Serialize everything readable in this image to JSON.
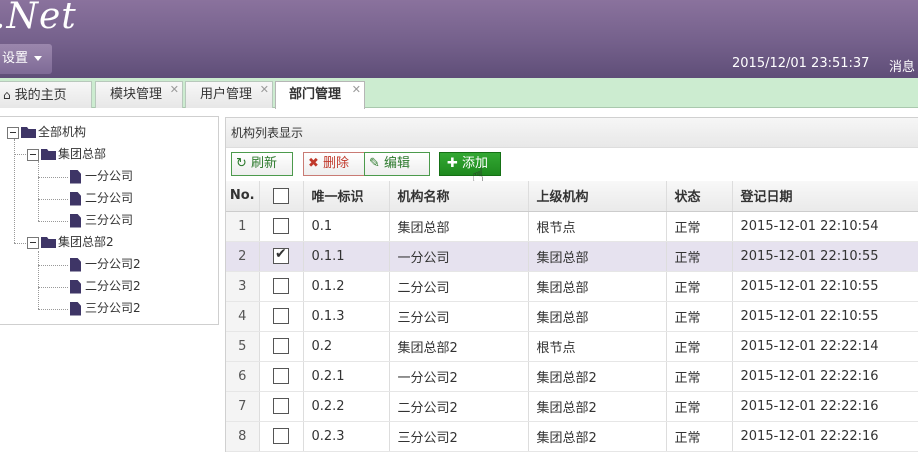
{
  "header": {
    "logo_text": ".Net",
    "settings_label": "设置",
    "datetime": "2015/12/01 23:51:37",
    "message_label": "消息 ("
  },
  "tabs": [
    {
      "label": "我的主页",
      "icon": "home-icon"
    },
    {
      "label": "模块管理"
    },
    {
      "label": "用户管理"
    },
    {
      "label": "部门管理",
      "active": true
    }
  ],
  "tree": {
    "root": "全部机构",
    "groups": [
      {
        "label": "集团总部",
        "children": [
          "一分公司",
          "二分公司",
          "三分公司"
        ]
      },
      {
        "label": "集团总部2",
        "children": [
          "一分公司2",
          "二分公司2",
          "三分公司2"
        ]
      }
    ]
  },
  "panel": {
    "title": "机构列表显示",
    "buttons": {
      "refresh": "刷新",
      "delete": "删除",
      "edit": "编辑",
      "add": "添加"
    }
  },
  "table": {
    "headers": [
      "No.",
      "",
      "唯一标识",
      "机构名称",
      "上级机构",
      "状态",
      "登记日期"
    ],
    "rows": [
      {
        "no": "1",
        "checked": false,
        "id": "0.1",
        "name": "集团总部",
        "parent": "根节点",
        "status": "正常",
        "date": "2015-12-01 22:10:54"
      },
      {
        "no": "2",
        "checked": true,
        "id": "0.1.1",
        "name": "一分公司",
        "parent": "集团总部",
        "status": "正常",
        "date": "2015-12-01 22:10:55"
      },
      {
        "no": "3",
        "checked": false,
        "id": "0.1.2",
        "name": "二分公司",
        "parent": "集团总部",
        "status": "正常",
        "date": "2015-12-01 22:10:55"
      },
      {
        "no": "4",
        "checked": false,
        "id": "0.1.3",
        "name": "三分公司",
        "parent": "集团总部",
        "status": "正常",
        "date": "2015-12-01 22:10:55"
      },
      {
        "no": "5",
        "checked": false,
        "id": "0.2",
        "name": "集团总部2",
        "parent": "根节点",
        "status": "正常",
        "date": "2015-12-01 22:22:14"
      },
      {
        "no": "6",
        "checked": false,
        "id": "0.2.1",
        "name": "一分公司2",
        "parent": "集团总部2",
        "status": "正常",
        "date": "2015-12-01 22:22:16"
      },
      {
        "no": "7",
        "checked": false,
        "id": "0.2.2",
        "name": "二分公司2",
        "parent": "集团总部2",
        "status": "正常",
        "date": "2015-12-01 22:22:16"
      },
      {
        "no": "8",
        "checked": false,
        "id": "0.2.3",
        "name": "三分公司2",
        "parent": "集团总部2",
        "status": "正常",
        "date": "2015-12-01 22:22:16"
      }
    ]
  }
}
